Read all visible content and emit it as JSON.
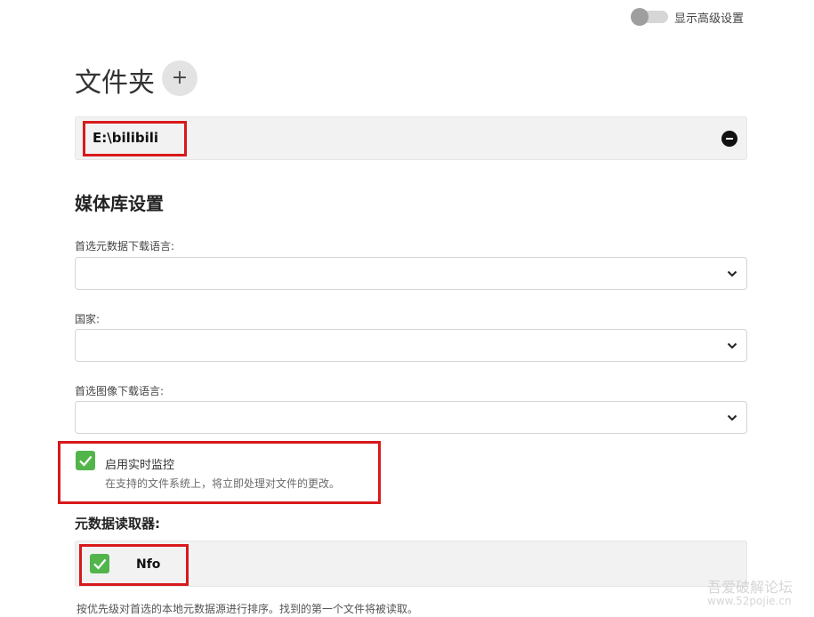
{
  "header": {
    "advanced_toggle_label": "显示高级设置",
    "advanced_enabled": false
  },
  "folders": {
    "title": "文件夹",
    "add_symbol": "+",
    "items": [
      {
        "path": "E:\\bilibili"
      }
    ]
  },
  "library_settings": {
    "title": "媒体库设置",
    "fields": [
      {
        "label": "首选元数据下载语言:",
        "value": ""
      },
      {
        "label": "国家:",
        "value": ""
      },
      {
        "label": "首选图像下载语言:",
        "value": ""
      }
    ],
    "realtime_monitor": {
      "checked": true,
      "label": "启用实时监控",
      "description": "在支持的文件系统上，将立即处理对文件的更改。"
    }
  },
  "metadata_readers": {
    "title": "元数据读取器:",
    "items": [
      {
        "name": "Nfo",
        "checked": true
      }
    ],
    "note": "按优先级对首选的本地元数据源进行排序。找到的第一个文件将被读取。"
  },
  "watermark": {
    "line1": "吾爱破解论坛",
    "line2": "www.52pojie.cn"
  },
  "colors": {
    "highlight": "#d8191b",
    "check_green": "#52b54b"
  },
  "icons": {
    "remove": "minus-circle-icon",
    "dropdown": "chevron-down-icon",
    "check": "check-icon"
  }
}
